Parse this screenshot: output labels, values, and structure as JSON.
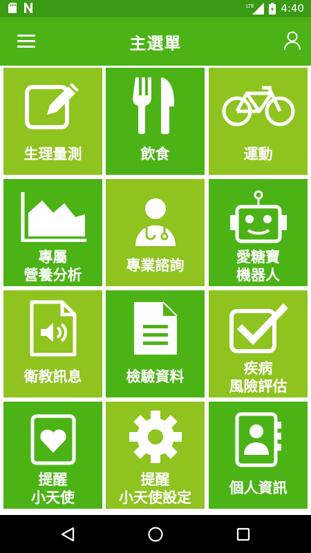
{
  "status": {
    "time": "4:40",
    "network": "LTE"
  },
  "appbar": {
    "title": "主選單"
  },
  "tiles": [
    {
      "line1": "生理量測",
      "line2": ""
    },
    {
      "line1": "飲食",
      "line2": ""
    },
    {
      "line1": "運動",
      "line2": ""
    },
    {
      "line1": "專屬",
      "line2": "營養分析"
    },
    {
      "line1": "專業諮詢",
      "line2": ""
    },
    {
      "line1": "愛糖寶",
      "line2": "機器人"
    },
    {
      "line1": "衛教訊息",
      "line2": ""
    },
    {
      "line1": "檢驗資料",
      "line2": ""
    },
    {
      "line1": "疾病",
      "line2": "風險評估"
    },
    {
      "line1": "提醒",
      "line2": "小天使"
    },
    {
      "line1": "提醒",
      "line2": "小天使設定"
    },
    {
      "line1": "個人資訊",
      "line2": ""
    }
  ],
  "colors": {
    "statusbar": "#3a9a14",
    "appbar": "#4cb317",
    "tile_light": "#8fc31f",
    "tile_dark": "#4cb317"
  }
}
